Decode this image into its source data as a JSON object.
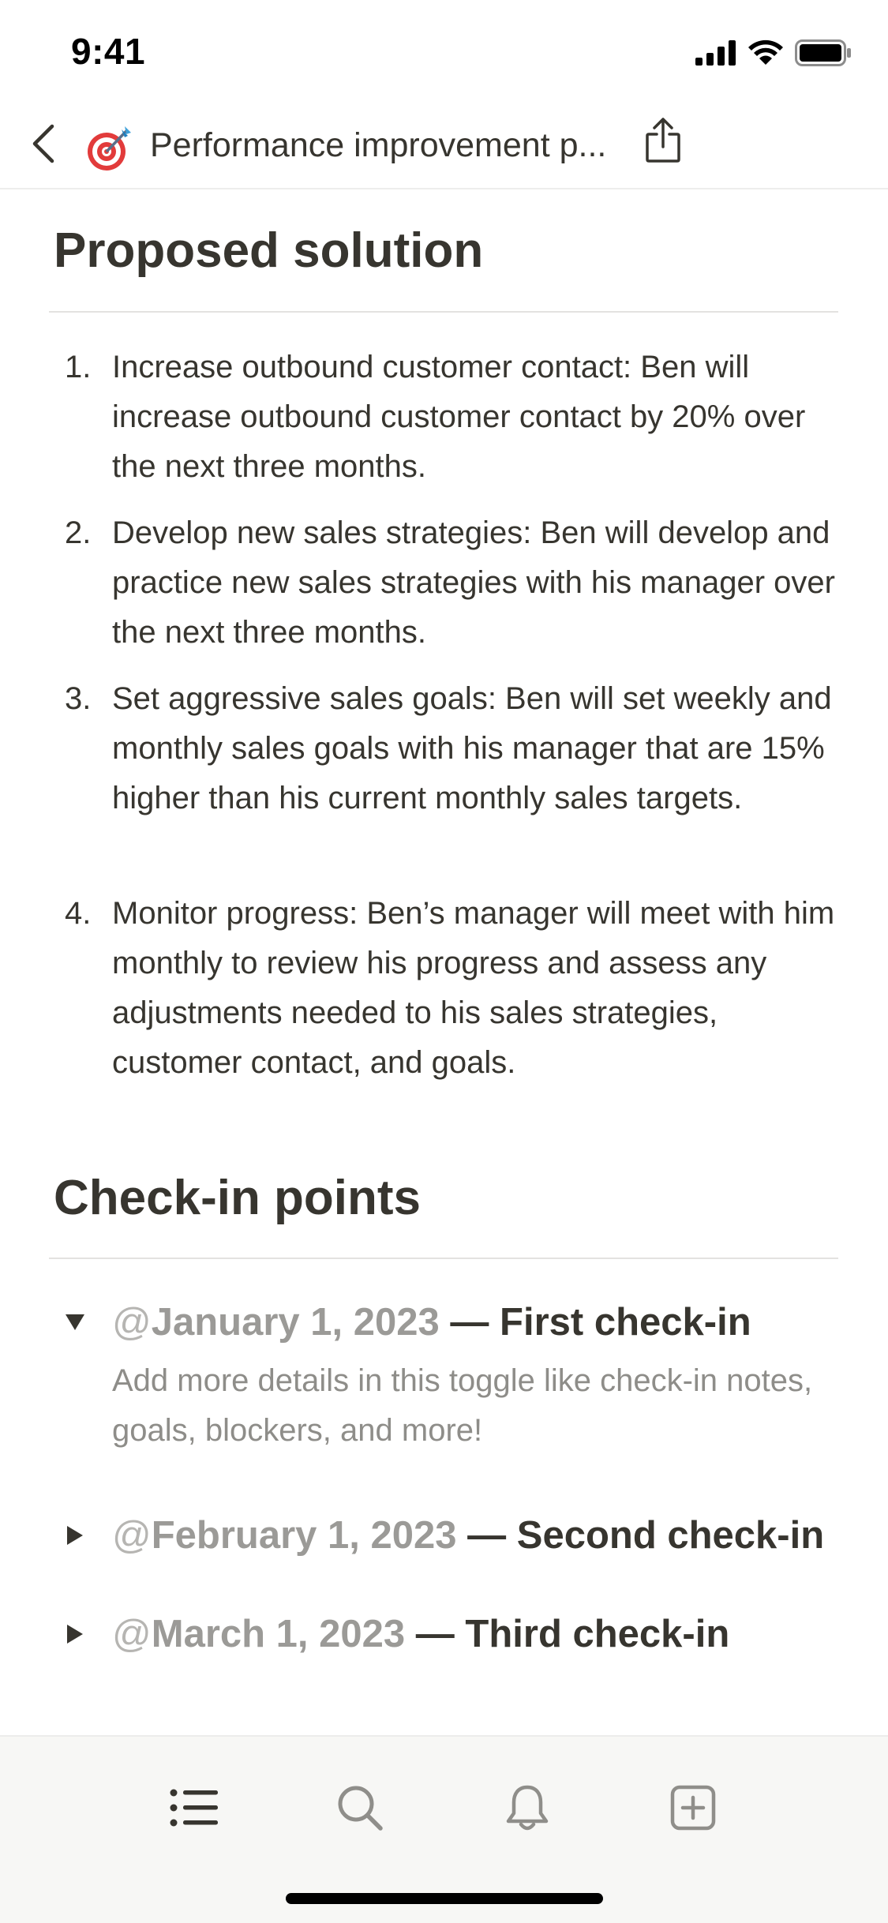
{
  "status_bar": {
    "time": "9:41",
    "icons": [
      "cellular-signal-icon",
      "wifi-icon",
      "battery-icon"
    ]
  },
  "nav": {
    "back_icon": "chevron-left-icon",
    "page_icon": "dart-target-emoji-icon",
    "title": "Performance improvement p...",
    "share_icon": "share-icon"
  },
  "proposed_solution": {
    "heading": "Proposed solution",
    "items": [
      {
        "number": "1.",
        "text": "Increase outbound customer contact: Ben will increase outbound customer contact by 20% over the next three months."
      },
      {
        "number": "2.",
        "text": "Develop new sales strategies: Ben will develop and practice new sales strategies with his manager over the next three months."
      },
      {
        "number": "3.",
        "text": "Set aggressive sales goals: Ben will set weekly and monthly sales goals with his manager that are 15% higher than his current monthly sales targets."
      },
      {
        "number": "4.",
        "text": "Monitor progress: Ben’s manager will meet with him monthly to review his progress and assess any adjustments needed to his sales strategies, customer contact, and goals."
      }
    ]
  },
  "check_in": {
    "heading": "Check-in points",
    "toggles": [
      {
        "at": "@",
        "date": "January 1, 2023",
        "title": " — First check-in",
        "expanded": true,
        "body": "Add more details in this toggle like check-in notes, goals, blockers, and more!"
      },
      {
        "at": "@",
        "date": "February 1, 2023",
        "title": " — Second check-in",
        "expanded": false
      },
      {
        "at": "@",
        "date": "March 1, 2023",
        "title": " — Third check-in",
        "expanded": false
      }
    ]
  },
  "toolbar": {
    "icons": [
      "list-icon",
      "search-icon",
      "bell-icon",
      "new-page-icon"
    ]
  },
  "colors": {
    "text": "#37352f",
    "muted": "#9b9a97",
    "toolbar_bg": "#f7f7f5",
    "divider": "#e3e2e0"
  }
}
